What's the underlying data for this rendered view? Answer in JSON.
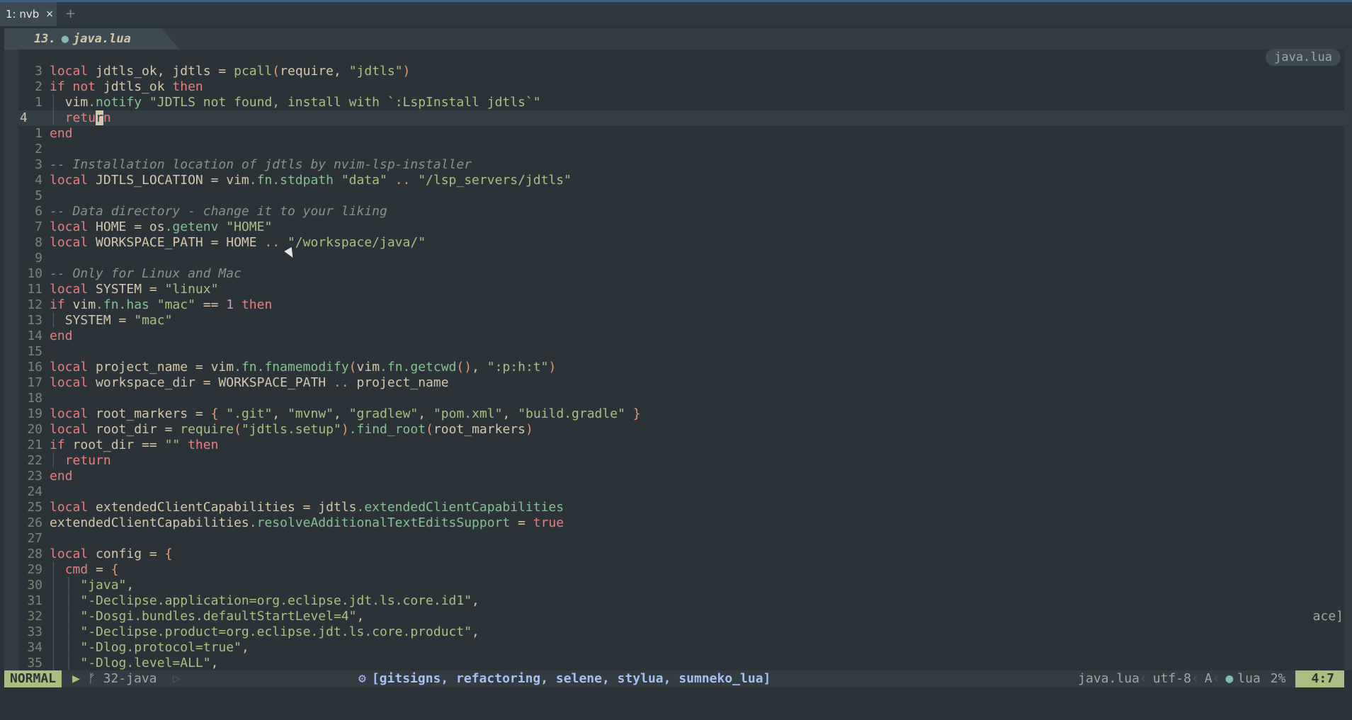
{
  "terminal": {
    "tab_label": "1: nvb",
    "close_glyph": "×",
    "new_tab_glyph": "+"
  },
  "buffer_tab": {
    "number": "13.",
    "filename": "java.lua"
  },
  "winbar": {
    "filename": "java.lua"
  },
  "truncated_text": "ace]",
  "statusline": {
    "mode": "NORMAL",
    "branch_icon": "ᚠ",
    "branch": "32-java",
    "lsp_clients": "[gitsigns, refactoring, selene, stylua, sumneko_lua]",
    "filename": "java.lua",
    "encoding": "utf-8",
    "format_icon": "A",
    "filetype": "lua",
    "percent": "2%",
    "position": "4:7"
  },
  "colors": {
    "mode_bg": "#a7c080",
    "background": "#2b3339",
    "keyword": "#e67e80",
    "string": "#a7c080",
    "comment": "#859289"
  },
  "code": [
    {
      "ln": "3",
      "segs": [
        [
          "kw",
          "local "
        ],
        [
          "pu",
          "jdtls_ok, jdtls = "
        ],
        [
          "fn",
          "pcall"
        ],
        [
          "op",
          "("
        ],
        [
          "pu",
          "require, "
        ],
        [
          "str",
          "\"jdtls\""
        ],
        [
          "op",
          ")"
        ]
      ]
    },
    {
      "ln": "2",
      "segs": [
        [
          "kw",
          "if not "
        ],
        [
          "pu",
          "jdtls_ok "
        ],
        [
          "kw",
          "then"
        ]
      ]
    },
    {
      "ln": "1",
      "segs": [
        [
          "ig",
          "│ "
        ],
        [
          "pu",
          "vim"
        ],
        [
          "field",
          ".notify "
        ],
        [
          "str",
          "\"JDTLS not found, install with `:LspInstall jdtls`\""
        ]
      ]
    },
    {
      "ln": "4",
      "current": true,
      "segs": [
        [
          "ig",
          "│ "
        ],
        [
          "kw",
          "retu"
        ],
        [
          "cursor",
          "r"
        ],
        [
          "kw",
          "n"
        ]
      ]
    },
    {
      "ln": "1",
      "segs": [
        [
          "kw",
          "end"
        ]
      ]
    },
    {
      "ln": "2",
      "segs": []
    },
    {
      "ln": "3",
      "segs": [
        [
          "cm",
          "-- Installation location of jdtls by nvim-lsp-installer"
        ]
      ]
    },
    {
      "ln": "4",
      "segs": [
        [
          "kw",
          "local "
        ],
        [
          "pu",
          "JDTLS_LOCATION = vim"
        ],
        [
          "field",
          ".fn.stdpath "
        ],
        [
          "str",
          "\"data\" "
        ],
        [
          "op",
          ".. "
        ],
        [
          "str",
          "\"/lsp_servers/jdtls\""
        ]
      ]
    },
    {
      "ln": "5",
      "segs": []
    },
    {
      "ln": "6",
      "segs": [
        [
          "cm",
          "-- Data directory - change it to your liking"
        ]
      ]
    },
    {
      "ln": "7",
      "segs": [
        [
          "kw",
          "local "
        ],
        [
          "pu",
          "HOME = os"
        ],
        [
          "field",
          ".getenv "
        ],
        [
          "str",
          "\"HOME\""
        ]
      ]
    },
    {
      "ln": "8",
      "segs": [
        [
          "kw",
          "local "
        ],
        [
          "pu",
          "WORKSPACE_PATH = HOME "
        ],
        [
          "op",
          ".. "
        ],
        [
          "str",
          "\"/workspace/java/\""
        ]
      ]
    },
    {
      "ln": "9",
      "segs": []
    },
    {
      "ln": "10",
      "segs": [
        [
          "cm",
          "-- Only for Linux and Mac"
        ]
      ]
    },
    {
      "ln": "11",
      "segs": [
        [
          "kw",
          "local "
        ],
        [
          "pu",
          "SYSTEM = "
        ],
        [
          "str",
          "\"linux\""
        ]
      ]
    },
    {
      "ln": "12",
      "segs": [
        [
          "kw",
          "if "
        ],
        [
          "pu",
          "vim"
        ],
        [
          "field",
          ".fn.has "
        ],
        [
          "str",
          "\"mac\" "
        ],
        [
          "pu",
          "== "
        ],
        [
          "num",
          "1 "
        ],
        [
          "kw",
          "then"
        ]
      ]
    },
    {
      "ln": "13",
      "segs": [
        [
          "ig",
          "│ "
        ],
        [
          "pu",
          "SYSTEM = "
        ],
        [
          "str",
          "\"mac\""
        ]
      ]
    },
    {
      "ln": "14",
      "segs": [
        [
          "kw",
          "end"
        ]
      ]
    },
    {
      "ln": "15",
      "segs": []
    },
    {
      "ln": "16",
      "segs": [
        [
          "kw",
          "local "
        ],
        [
          "pu",
          "project_name = vim"
        ],
        [
          "field",
          ".fn.fnamemodify"
        ],
        [
          "op",
          "("
        ],
        [
          "pu",
          "vim"
        ],
        [
          "field",
          ".fn.getcwd"
        ],
        [
          "op",
          "()"
        ],
        [
          "pu",
          ", "
        ],
        [
          "str",
          "\":p:h:t\""
        ],
        [
          "op",
          ")"
        ]
      ]
    },
    {
      "ln": "17",
      "segs": [
        [
          "kw",
          "local "
        ],
        [
          "pu",
          "workspace_dir = WORKSPACE_PATH "
        ],
        [
          "op",
          ".. "
        ],
        [
          "pu",
          "project_name"
        ]
      ]
    },
    {
      "ln": "18",
      "segs": []
    },
    {
      "ln": "19",
      "segs": [
        [
          "kw",
          "local "
        ],
        [
          "pu",
          "root_markers = "
        ],
        [
          "op",
          "{ "
        ],
        [
          "str",
          "\".git\""
        ],
        [
          "pu",
          ", "
        ],
        [
          "str",
          "\"mvnw\""
        ],
        [
          "pu",
          ", "
        ],
        [
          "str",
          "\"gradlew\""
        ],
        [
          "pu",
          ", "
        ],
        [
          "str",
          "\"pom.xml\""
        ],
        [
          "pu",
          ", "
        ],
        [
          "str",
          "\"build.gradle\" "
        ],
        [
          "op",
          "}"
        ]
      ]
    },
    {
      "ln": "20",
      "segs": [
        [
          "kw",
          "local "
        ],
        [
          "pu",
          "root_dir = "
        ],
        [
          "fn",
          "require"
        ],
        [
          "op",
          "("
        ],
        [
          "str",
          "\"jdtls.setup\""
        ],
        [
          "op",
          ")"
        ],
        [
          "field",
          ".find_root"
        ],
        [
          "op",
          "("
        ],
        [
          "pu",
          "root_markers"
        ],
        [
          "op",
          ")"
        ]
      ]
    },
    {
      "ln": "21",
      "segs": [
        [
          "kw",
          "if "
        ],
        [
          "pu",
          "root_dir == "
        ],
        [
          "str",
          "\"\" "
        ],
        [
          "kw",
          "then"
        ]
      ]
    },
    {
      "ln": "22",
      "segs": [
        [
          "ig",
          "│ "
        ],
        [
          "kw",
          "return"
        ]
      ]
    },
    {
      "ln": "23",
      "segs": [
        [
          "kw",
          "end"
        ]
      ]
    },
    {
      "ln": "24",
      "segs": []
    },
    {
      "ln": "25",
      "segs": [
        [
          "kw",
          "local "
        ],
        [
          "pu",
          "extendedClientCapabilities = jdtls"
        ],
        [
          "field",
          ".extendedClientCapabilities"
        ]
      ]
    },
    {
      "ln": "26",
      "segs": [
        [
          "pu",
          "extendedClientCapabilities"
        ],
        [
          "field",
          ".resolveAdditionalTextEditsSupport "
        ],
        [
          "pu",
          "= "
        ],
        [
          "kw",
          "true"
        ]
      ]
    },
    {
      "ln": "27",
      "segs": []
    },
    {
      "ln": "28",
      "segs": [
        [
          "kw",
          "local "
        ],
        [
          "pu",
          "config = "
        ],
        [
          "op",
          "{"
        ]
      ]
    },
    {
      "ln": "29",
      "segs": [
        [
          "ig",
          "│ "
        ],
        [
          "kw",
          "cmd "
        ],
        [
          "pu",
          "= "
        ],
        [
          "op",
          "{"
        ]
      ]
    },
    {
      "ln": "30",
      "segs": [
        [
          "ig",
          "│ │ "
        ],
        [
          "str",
          "\"java\""
        ],
        [
          "pu",
          ","
        ]
      ]
    },
    {
      "ln": "31",
      "segs": [
        [
          "ig",
          "│ │ "
        ],
        [
          "str",
          "\"-Declipse.application=org.eclipse.jdt.ls.core.id1\""
        ],
        [
          "pu",
          ","
        ]
      ]
    },
    {
      "ln": "32",
      "segs": [
        [
          "ig",
          "│ │ "
        ],
        [
          "str",
          "\"-Dosgi.bundles.defaultStartLevel=4\""
        ],
        [
          "pu",
          ","
        ]
      ]
    },
    {
      "ln": "33",
      "segs": [
        [
          "ig",
          "│ │ "
        ],
        [
          "str",
          "\"-Declipse.product=org.eclipse.jdt.ls.core.product\""
        ],
        [
          "pu",
          ","
        ]
      ]
    },
    {
      "ln": "34",
      "segs": [
        [
          "ig",
          "│ │ "
        ],
        [
          "str",
          "\"-Dlog.protocol=true\""
        ],
        [
          "pu",
          ","
        ]
      ]
    },
    {
      "ln": "35",
      "segs": [
        [
          "ig",
          "│ │ "
        ],
        [
          "str",
          "\"-Dlog.level=ALL\""
        ],
        [
          "pu",
          ","
        ]
      ]
    }
  ]
}
